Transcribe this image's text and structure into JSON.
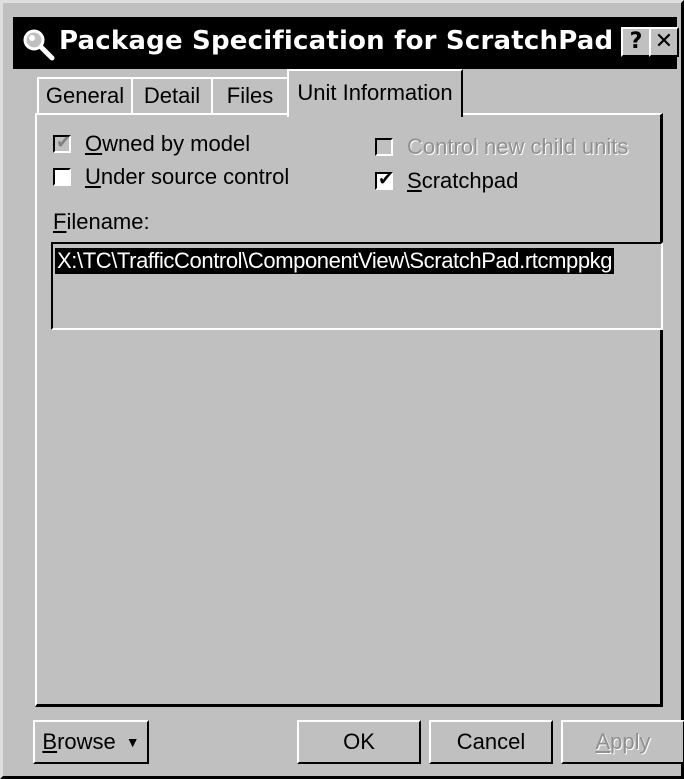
{
  "window": {
    "title": "Package Specification for ScratchPad",
    "help_button": "?",
    "close_button": "✕"
  },
  "tabs": {
    "general": "General",
    "detail": "Detail",
    "files": "Files",
    "unit_information": "Unit Information",
    "active": "Unit Information"
  },
  "options": {
    "owned_by_model": {
      "label_first": "O",
      "label_rest": "wned by model",
      "checked": true,
      "enabled": false
    },
    "under_source_control": {
      "label_first": "U",
      "label_rest": "nder source control",
      "checked": false,
      "enabled": true
    },
    "control_new_child_units": {
      "label": "Control new child units",
      "checked": false,
      "enabled": false
    },
    "scratchpad": {
      "label_first": "S",
      "label_rest": "cratchpad",
      "checked": true,
      "enabled": true
    }
  },
  "filename": {
    "label_first": "F",
    "label_rest": "ilename:",
    "value": "X:\\TC\\TrafficControl\\ComponentView\\ScratchPad.rtcmppkg"
  },
  "buttons": {
    "browse_first": "B",
    "browse_rest": "rowse",
    "browse_arrow": "▼",
    "ok": "OK",
    "cancel": "Cancel",
    "apply_first": "A",
    "apply_rest": "pply"
  },
  "icons": {
    "title_icon": "magnifier-icon",
    "check": "✔"
  }
}
